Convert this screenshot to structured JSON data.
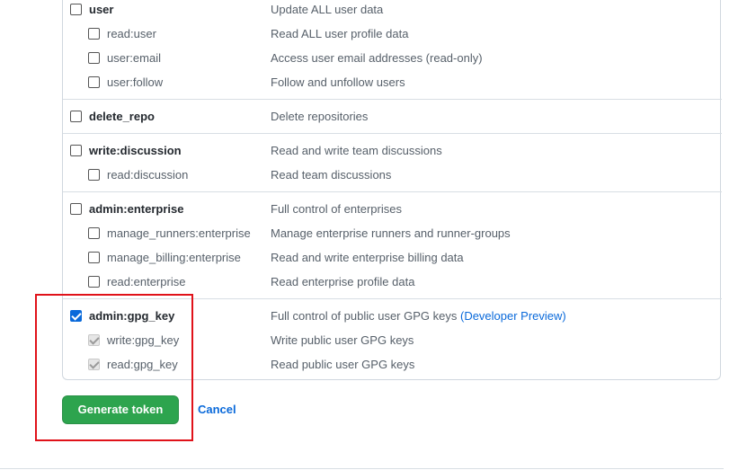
{
  "scope_groups": [
    {
      "parent": {
        "name": "user",
        "description": "Update ALL user data",
        "checked": false
      },
      "children": [
        {
          "name": "read:user",
          "description": "Read ALL user profile data",
          "checked": false
        },
        {
          "name": "user:email",
          "description": "Access user email addresses (read-only)",
          "checked": false
        },
        {
          "name": "user:follow",
          "description": "Follow and unfollow users",
          "checked": false
        }
      ]
    },
    {
      "parent": {
        "name": "delete_repo",
        "description": "Delete repositories",
        "checked": false
      },
      "children": []
    },
    {
      "parent": {
        "name": "write:discussion",
        "description": "Read and write team discussions",
        "checked": false
      },
      "children": [
        {
          "name": "read:discussion",
          "description": "Read team discussions",
          "checked": false
        }
      ]
    },
    {
      "parent": {
        "name": "admin:enterprise",
        "description": "Full control of enterprises",
        "checked": false
      },
      "children": [
        {
          "name": "manage_runners:enterprise",
          "description": "Manage enterprise runners and runner-groups",
          "checked": false
        },
        {
          "name": "manage_billing:enterprise",
          "description": "Read and write enterprise billing data",
          "checked": false
        },
        {
          "name": "read:enterprise",
          "description": "Read enterprise profile data",
          "checked": false
        }
      ]
    },
    {
      "parent": {
        "name": "admin:gpg_key",
        "description": "Full control of public user GPG keys",
        "extra_link": "(Developer Preview)",
        "checked": true
      },
      "children": [
        {
          "name": "write:gpg_key",
          "description": "Write public user GPG keys",
          "checked": true,
          "disabled": true
        },
        {
          "name": "read:gpg_key",
          "description": "Read public user GPG keys",
          "checked": true,
          "disabled": true
        }
      ]
    }
  ],
  "actions": {
    "generate_label": "Generate token",
    "cancel_label": "Cancel"
  },
  "colors": {
    "primary_button": "#2da44e",
    "link": "#0969da",
    "annotation": "#e0121a"
  }
}
